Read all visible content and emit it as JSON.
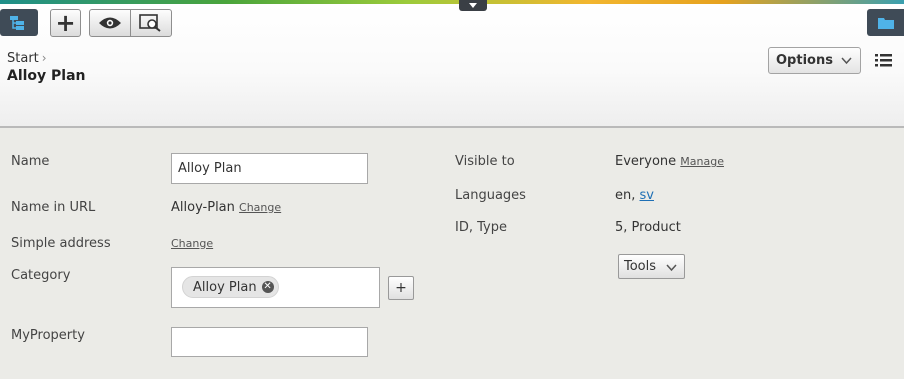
{
  "toolbar": {
    "navigation_icon": "site-tree-icon",
    "add_label": "+",
    "preview_icon": "eye-icon",
    "compare_icon": "preview-search-icon",
    "assets_icon": "folder-icon"
  },
  "breadcrumb": {
    "start": "Start"
  },
  "page": {
    "title": "Alloy Plan"
  },
  "header_actions": {
    "options_label": "Options",
    "list_icon": "list-icon"
  },
  "form": {
    "name_label": "Name",
    "name_value": "Alloy Plan",
    "url_label": "Name in URL",
    "url_value": "Alloy-Plan",
    "url_change": "Change",
    "simple_label": "Simple address",
    "simple_change": "Change",
    "category_label": "Category",
    "category_chip": "Alloy Plan",
    "category_add": "+",
    "myproperty_label": "MyProperty",
    "myproperty_value": ""
  },
  "info": {
    "visible_label": "Visible to",
    "visible_value": "Everyone",
    "visible_manage": "Manage",
    "languages_label": "Languages",
    "lang_primary": "en,",
    "lang_link": "sv",
    "id_label": "ID, Type",
    "id_value": "5, Product",
    "tools_label": "Tools"
  }
}
